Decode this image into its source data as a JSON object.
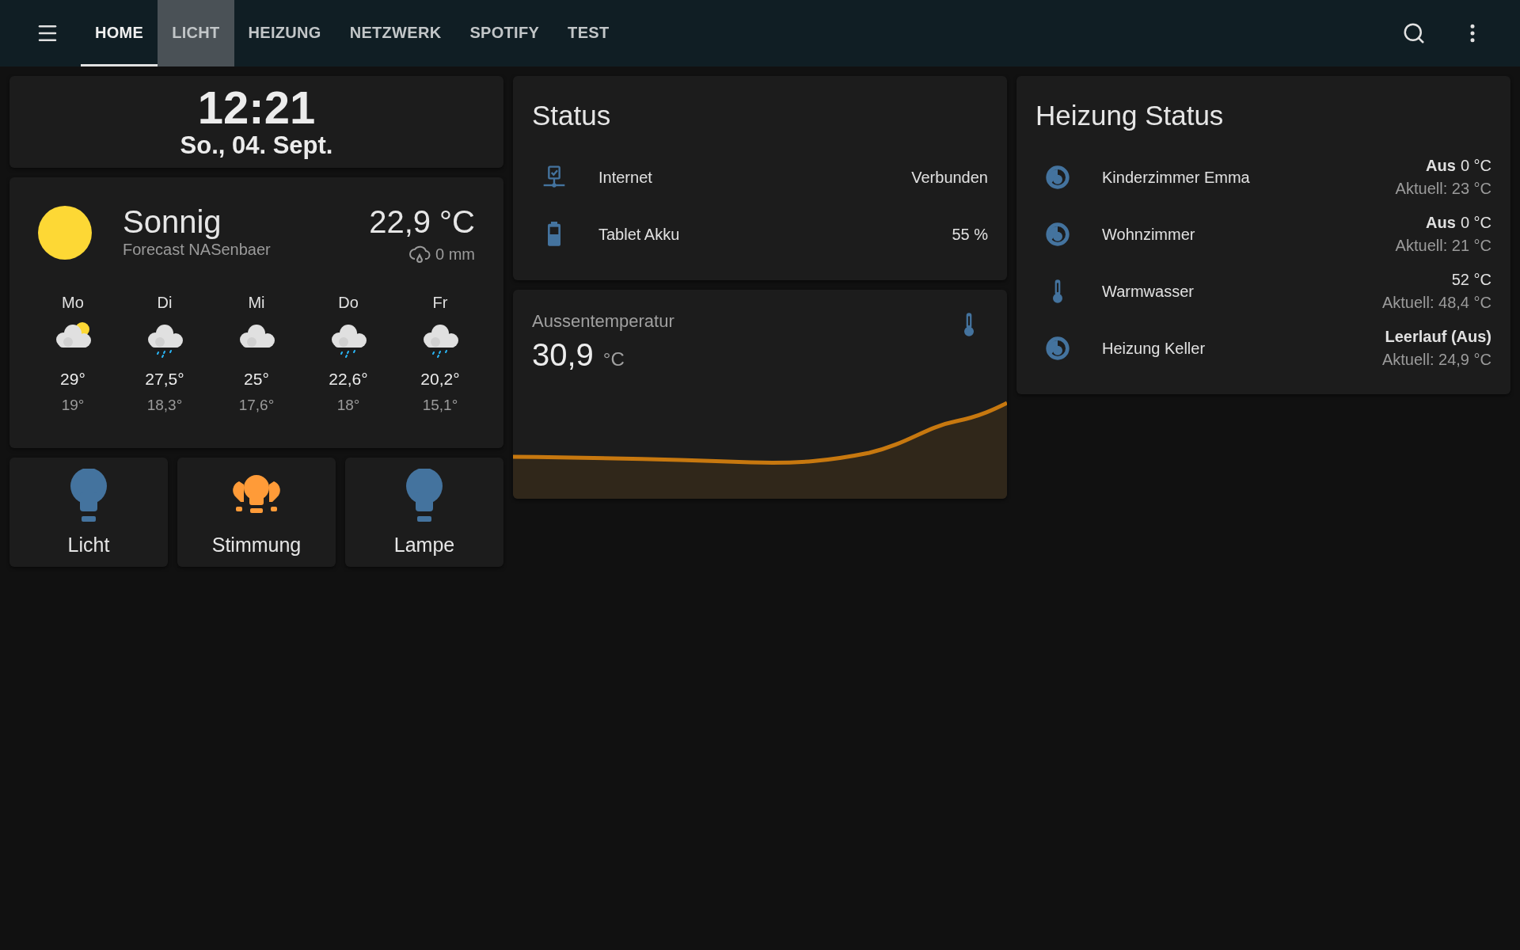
{
  "header": {
    "tabs": [
      {
        "label": "HOME",
        "selected": true,
        "hovered": false
      },
      {
        "label": "LICHT",
        "selected": false,
        "hovered": true
      },
      {
        "label": "HEIZUNG",
        "selected": false,
        "hovered": false
      },
      {
        "label": "NETZWERK",
        "selected": false,
        "hovered": false
      },
      {
        "label": "SPOTIFY",
        "selected": false,
        "hovered": false
      },
      {
        "label": "TEST",
        "selected": false,
        "hovered": false
      }
    ]
  },
  "clock": {
    "time": "12:21",
    "date": "So., 04. Sept."
  },
  "weather": {
    "kind": "sunny",
    "condition": "Sonnig",
    "source": "Forecast NASenbaer",
    "temperature": "22,9 °C",
    "precipitation": "0 mm",
    "forecast": [
      {
        "day": "Mo",
        "kind": "partly-cloudy",
        "high": "29°",
        "low": "19°"
      },
      {
        "day": "Di",
        "kind": "rainy",
        "high": "27,5°",
        "low": "18,3°"
      },
      {
        "day": "Mi",
        "kind": "cloudy",
        "high": "25°",
        "low": "17,6°"
      },
      {
        "day": "Do",
        "kind": "rainy",
        "high": "22,6°",
        "low": "18°"
      },
      {
        "day": "Fr",
        "kind": "rainy",
        "high": "20,2°",
        "low": "15,1°"
      }
    ]
  },
  "lights": [
    {
      "label": "Licht",
      "kind": "bulb",
      "on": false
    },
    {
      "label": "Stimmung",
      "kind": "bulb-group",
      "on": true
    },
    {
      "label": "Lampe",
      "kind": "bulb",
      "on": false
    }
  ],
  "status": {
    "title": "Status",
    "rows": [
      {
        "kind": "network",
        "name": "Internet",
        "value": "Verbunden"
      },
      {
        "kind": "battery",
        "name": "Tablet Akku",
        "value": "55 %"
      }
    ]
  },
  "outside": {
    "title": "Aussentemperatur",
    "value": "30,9",
    "unit": "°C"
  },
  "heating": {
    "title": "Heizung Status",
    "rows": [
      {
        "kind": "thermostat",
        "name": "Kinderzimmer Emma",
        "mode": "Aus",
        "target": "0 °C",
        "current": "Aktuell: 23 °C"
      },
      {
        "kind": "thermostat",
        "name": "Wohnzimmer",
        "mode": "Aus",
        "target": "0 °C",
        "current": "Aktuell: 21 °C"
      },
      {
        "kind": "water",
        "name": "Warmwasser",
        "target": "52 °C",
        "current": "Aktuell: 48,4 °C"
      },
      {
        "kind": "thermostat",
        "name": "Heizung Keller",
        "mode": "Leerlauf (Aus)",
        "current": "Aktuell: 24,9 °C"
      }
    ]
  }
}
